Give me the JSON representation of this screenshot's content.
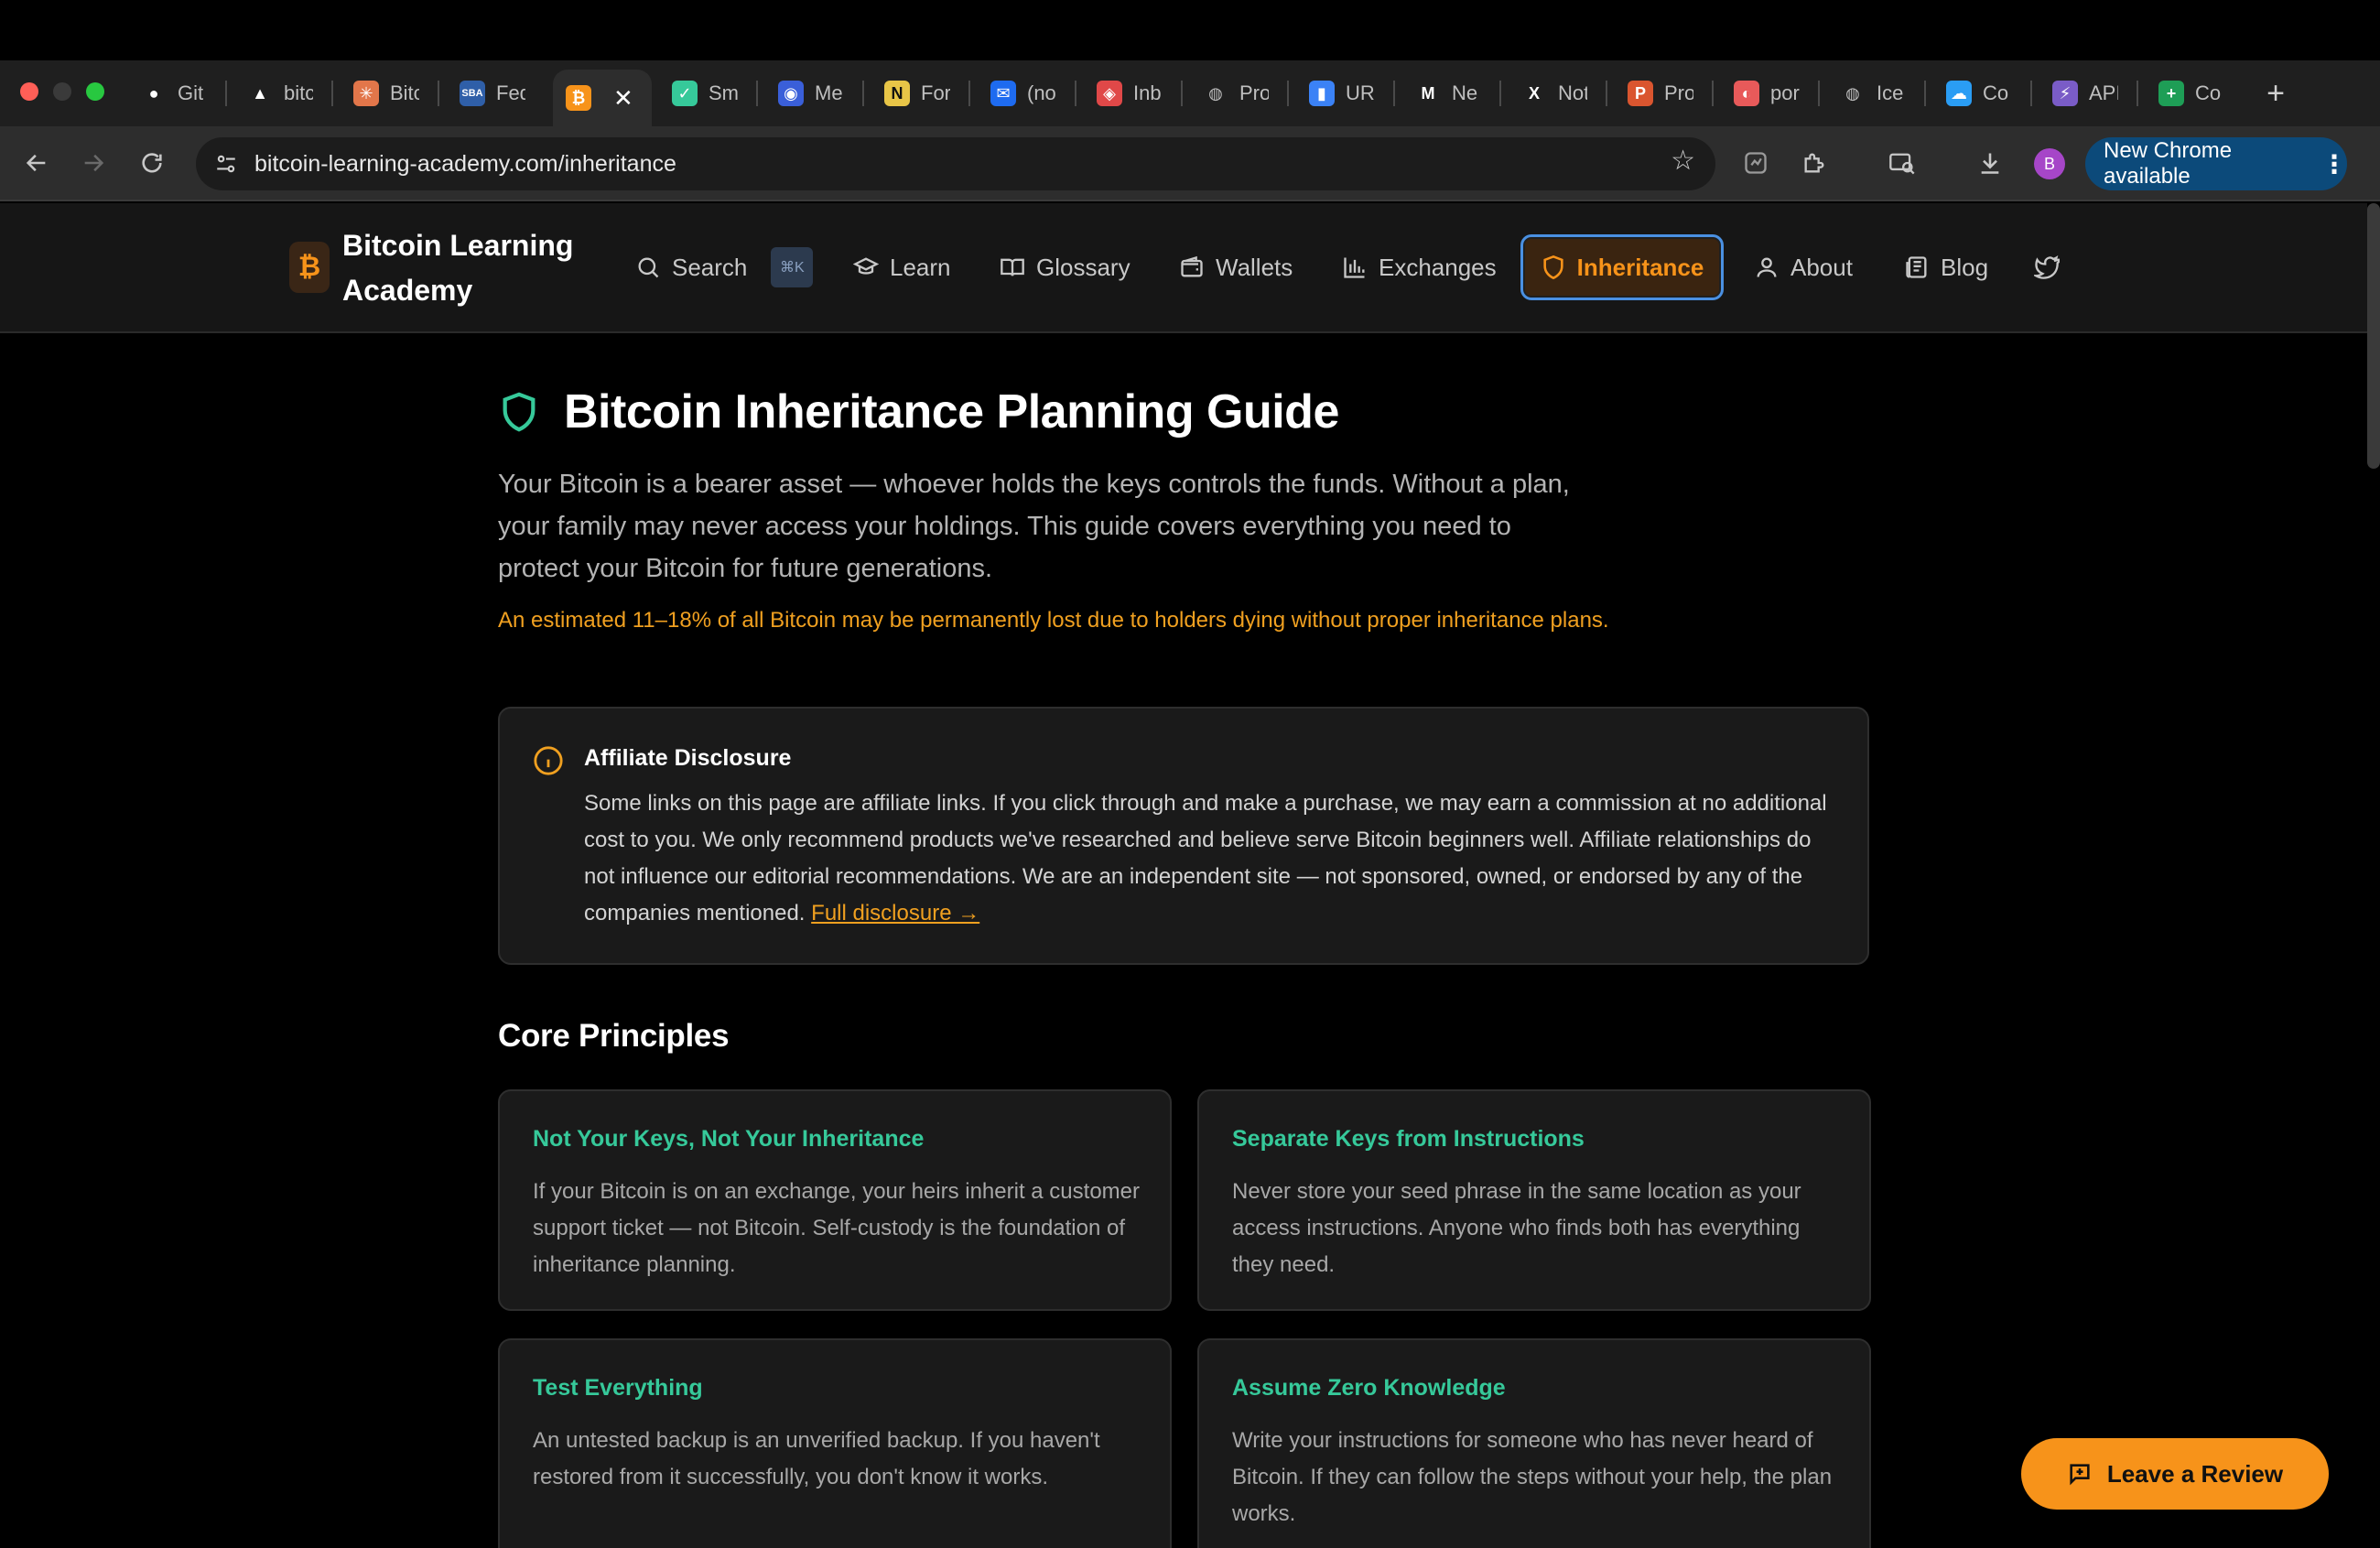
{
  "browser": {
    "tabs": [
      {
        "title": "Git",
        "icon": "github-icon",
        "color": "#ffffff"
      },
      {
        "title": "bitc",
        "icon": "vercel-icon",
        "color": "#ffffff"
      },
      {
        "title": "Bitc",
        "icon": "sparkle-icon",
        "color": "#e2764a"
      },
      {
        "title": "Fed",
        "icon": "sba-icon",
        "color": "#2f5fa8"
      },
      {
        "title": "",
        "icon": "bitcoin-icon",
        "color": "#f7931a",
        "active": true
      },
      {
        "title": "Sm",
        "icon": "shield-check-icon",
        "color": "#36c99a"
      },
      {
        "title": "Me",
        "icon": "target-icon",
        "color": "#3a5fd9"
      },
      {
        "title": "For",
        "icon": "n-logo-icon",
        "color": "#e8c547"
      },
      {
        "title": "(no",
        "icon": "mail-icon",
        "color": "#1e6bf0"
      },
      {
        "title": "Inb",
        "icon": "cube-icon",
        "color": "#e04848"
      },
      {
        "title": "Pro",
        "icon": "globe-icon",
        "color": "#bfbfbf"
      },
      {
        "title": "UR",
        "icon": "analytics-icon",
        "color": "#3b82f6"
      },
      {
        "title": "Ne",
        "icon": "medium-icon",
        "color": "#ffffff"
      },
      {
        "title": "Not",
        "icon": "x-logo-icon",
        "color": "#ffffff"
      },
      {
        "title": "Pro",
        "icon": "producthunt-icon",
        "color": "#da552f"
      },
      {
        "title": "por",
        "icon": "portfolio-icon",
        "color": "#e85a5a"
      },
      {
        "title": "Ice",
        "icon": "globe-icon",
        "color": "#bfbfbf"
      },
      {
        "title": "Co",
        "icon": "cloud-icon",
        "color": "#2a9df4"
      },
      {
        "title": "API",
        "icon": "api-icon",
        "color": "#7a5cc7"
      },
      {
        "title": "Co",
        "icon": "sheets-icon",
        "color": "#1e9e56"
      }
    ],
    "new_tab_label": "+",
    "url": "bitcoin-learning-academy.com/inheritance",
    "profile_initial": "B",
    "update_label": "New Chrome available"
  },
  "site": {
    "logo_symbol": "₿",
    "logo_text": "Bitcoin Learning Academy",
    "nav": {
      "search": "Search",
      "search_shortcut": "⌘K",
      "learn": "Learn",
      "glossary": "Glossary",
      "wallets": "Wallets",
      "exchanges": "Exchanges",
      "inheritance": "Inheritance",
      "about": "About",
      "blog": "Blog"
    }
  },
  "page": {
    "title": "Bitcoin Inheritance Planning Guide",
    "intro": "Your Bitcoin is a bearer asset — whoever holds the keys controls the funds. Without a plan, your family may never access your holdings. This guide covers everything you need to protect your Bitcoin for future generations.",
    "stat": "An estimated 11–18% of all Bitcoin may be permanently lost due to holders dying without proper inheritance plans.",
    "disclosure": {
      "title": "Affiliate Disclosure",
      "body": "Some links on this page are affiliate links. If you click through and make a purchase, we may earn a commission at no additional cost to you. We only recommend products we've researched and believe serve Bitcoin beginners well. Affiliate relationships do not influence our editorial recommendations. We are an independent site — not sponsored, owned, or endorsed by any of the companies mentioned.",
      "link": "Full disclosure →"
    },
    "section_title": "Core Principles",
    "principles": [
      {
        "title": "Not Your Keys, Not Your Inheritance",
        "body": "If your Bitcoin is on an exchange, your heirs inherit a customer support ticket — not Bitcoin. Self-custody is the foundation of inheritance planning."
      },
      {
        "title": "Separate Keys from Instructions",
        "body": "Never store your seed phrase in the same location as your access instructions. Anyone who finds both has everything they need."
      },
      {
        "title": "Test Everything",
        "body": "An untested backup is an unverified backup. If you haven't restored from it successfully, you don't know it works."
      },
      {
        "title": "Assume Zero Knowledge",
        "body": "Write your instructions for someone who has never heard of Bitcoin. If they can follow the steps without your help, the plan works."
      }
    ],
    "review_button": "Leave a Review"
  },
  "colors": {
    "accent": "#f7931a",
    "principle_title": "#36c99a",
    "focus_ring": "#4a90e2"
  }
}
